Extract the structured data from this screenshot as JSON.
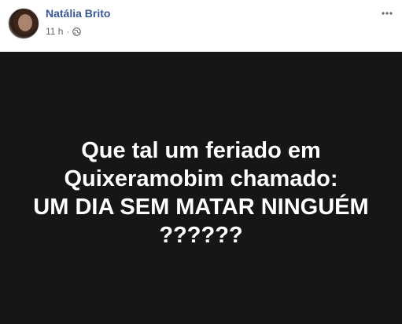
{
  "post": {
    "author": "Natália Brito",
    "timestamp": "11 h",
    "separator": "·",
    "privacy_icon": "globe-icon",
    "more_icon": "more-options-icon",
    "image": {
      "background": "#161616",
      "lines": [
        "Que tal um feriado em",
        "Quixeramobim chamado:",
        "UM DIA SEM MATAR NINGUÉM",
        "??????"
      ]
    }
  },
  "colors": {
    "author_name": "#385898",
    "meta_text": "#616770",
    "image_text": "#ffffff"
  }
}
